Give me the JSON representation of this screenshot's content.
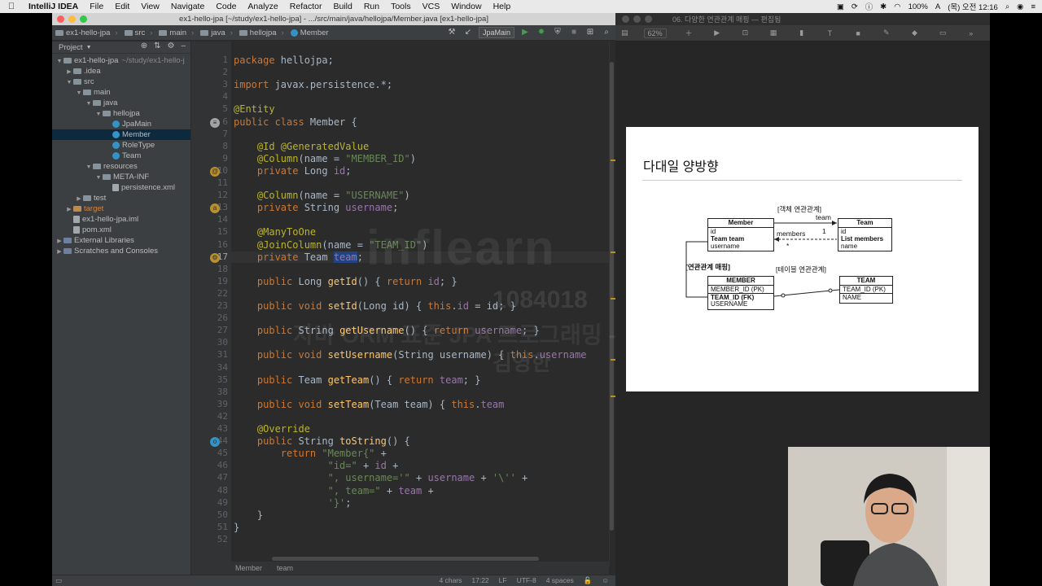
{
  "menubar": {
    "app_name": "IntelliJ IDEA",
    "items": [
      "File",
      "Edit",
      "View",
      "Navigate",
      "Code",
      "Analyze",
      "Refactor",
      "Build",
      "Run",
      "Tools",
      "VCS",
      "Window",
      "Help"
    ],
    "battery": "100%",
    "clock": "(목) 오전 12:16"
  },
  "ide": {
    "window_title": "ex1-hello-jpa [~/study/ex1-hello-jpa] - .../src/main/java/hellojpa/Member.java [ex1-hello-jpa]",
    "breadcrumbs": [
      "ex1-hello-jpa",
      "src",
      "main",
      "java",
      "hellojpa",
      "Member"
    ],
    "run_config": "JpaMain",
    "project_panel": {
      "title": "Project",
      "tree": [
        {
          "label": "ex1-hello-jpa",
          "extra": "~/study/ex1-hello-j",
          "indent": 0,
          "arrow": "▼",
          "kind": "folder"
        },
        {
          "label": ".idea",
          "indent": 1,
          "arrow": "▶",
          "kind": "folder"
        },
        {
          "label": "src",
          "indent": 1,
          "arrow": "▼",
          "kind": "folder"
        },
        {
          "label": "main",
          "indent": 2,
          "arrow": "▼",
          "kind": "folder"
        },
        {
          "label": "java",
          "indent": 3,
          "arrow": "▼",
          "kind": "folder"
        },
        {
          "label": "hellojpa",
          "indent": 4,
          "arrow": "▼",
          "kind": "folder"
        },
        {
          "label": "JpaMain",
          "indent": 5,
          "arrow": "",
          "kind": "class"
        },
        {
          "label": "Member",
          "indent": 5,
          "arrow": "",
          "kind": "class",
          "selected": true
        },
        {
          "label": "RoleType",
          "indent": 5,
          "arrow": "",
          "kind": "class"
        },
        {
          "label": "Team",
          "indent": 5,
          "arrow": "",
          "kind": "class"
        },
        {
          "label": "resources",
          "indent": 3,
          "arrow": "▼",
          "kind": "folder"
        },
        {
          "label": "META-INF",
          "indent": 4,
          "arrow": "▼",
          "kind": "folder"
        },
        {
          "label": "persistence.xml",
          "indent": 5,
          "arrow": "",
          "kind": "file"
        },
        {
          "label": "test",
          "indent": 2,
          "arrow": "▶",
          "kind": "folder"
        },
        {
          "label": "target",
          "indent": 1,
          "arrow": "▶",
          "kind": "folder-orange"
        },
        {
          "label": "ex1-hello-jpa.iml",
          "indent": 1,
          "arrow": "",
          "kind": "file"
        },
        {
          "label": "pom.xml",
          "indent": 1,
          "arrow": "",
          "kind": "file"
        },
        {
          "label": "External Libraries",
          "indent": 0,
          "arrow": "▶",
          "kind": "lib"
        },
        {
          "label": "Scratches and Consoles",
          "indent": 0,
          "arrow": "▶",
          "kind": "lib"
        }
      ]
    },
    "line_numbers": [
      "1",
      "2",
      "3",
      "4",
      "5",
      "6",
      "7",
      "8",
      "9",
      "10",
      "11",
      "12",
      "13",
      "14",
      "15",
      "16",
      "17",
      "18",
      "19",
      "22",
      "23",
      "26",
      "27",
      "30",
      "31",
      "34",
      "35",
      "38",
      "39",
      "42",
      "43",
      "44",
      "45",
      "46",
      "47",
      "48",
      "49",
      "50",
      "51",
      "52"
    ],
    "code_lines": [
      [
        [
          "kw",
          "package "
        ],
        [
          "",
          "hellojpa;"
        ]
      ],
      [],
      [
        [
          "kw",
          "import "
        ],
        [
          "",
          "javax.persistence.*;"
        ]
      ],
      [],
      [
        [
          "ann",
          "@Entity"
        ]
      ],
      [
        [
          "kw",
          "public class "
        ],
        [
          "",
          "Member {"
        ]
      ],
      [],
      [
        [
          "",
          "    "
        ],
        [
          "ann",
          "@Id @GeneratedValue"
        ]
      ],
      [
        [
          "",
          "    "
        ],
        [
          "ann",
          "@Column"
        ],
        [
          "",
          "(name = "
        ],
        [
          "str",
          "\"MEMBER_ID\""
        ],
        [
          "",
          ")"
        ]
      ],
      [
        [
          "",
          "    "
        ],
        [
          "kw",
          "private "
        ],
        [
          "",
          "Long "
        ],
        [
          "fld",
          "id"
        ],
        [
          "",
          ";"
        ]
      ],
      [],
      [
        [
          "",
          "    "
        ],
        [
          "ann",
          "@Column"
        ],
        [
          "",
          "(name = "
        ],
        [
          "str",
          "\"USERNAME\""
        ],
        [
          "",
          ")"
        ]
      ],
      [
        [
          "",
          "    "
        ],
        [
          "kw",
          "private "
        ],
        [
          "",
          "String "
        ],
        [
          "fld",
          "username"
        ],
        [
          "",
          ";"
        ]
      ],
      [],
      [
        [
          "",
          "    "
        ],
        [
          "ann",
          "@ManyToOne"
        ]
      ],
      [
        [
          "",
          "    "
        ],
        [
          "ann",
          "@JoinColumn"
        ],
        [
          "",
          "(name = "
        ],
        [
          "str",
          "\"TEAM_ID\""
        ],
        [
          "",
          ")"
        ]
      ],
      [
        [
          "",
          "    "
        ],
        [
          "kw",
          "private "
        ],
        [
          "",
          "Team "
        ],
        [
          "fldsel",
          "team"
        ],
        [
          "",
          ";"
        ]
      ],
      [],
      [
        [
          "",
          "    "
        ],
        [
          "kw",
          "public "
        ],
        [
          "",
          "Long "
        ],
        [
          "mth",
          "getId"
        ],
        [
          "",
          "() { "
        ],
        [
          "kw",
          "return "
        ],
        [
          "fld",
          "id"
        ],
        [
          "",
          "; }"
        ]
      ],
      [],
      [
        [
          "",
          "    "
        ],
        [
          "kw",
          "public void "
        ],
        [
          "mth",
          "setId"
        ],
        [
          "",
          "(Long id) { "
        ],
        [
          "kw",
          "this"
        ],
        [
          "",
          "."
        ],
        [
          "fld",
          "id"
        ],
        [
          "",
          " = id; }"
        ]
      ],
      [],
      [
        [
          "",
          "    "
        ],
        [
          "kw",
          "public "
        ],
        [
          "",
          "String "
        ],
        [
          "mth",
          "getUsername"
        ],
        [
          "",
          "() { "
        ],
        [
          "kw",
          "return "
        ],
        [
          "fld",
          "username"
        ],
        [
          "",
          "; }"
        ]
      ],
      [],
      [
        [
          "",
          "    "
        ],
        [
          "kw",
          "public void "
        ],
        [
          "mth",
          "setUsername"
        ],
        [
          "",
          "(String username) { "
        ],
        [
          "kw",
          "this"
        ],
        [
          "",
          "."
        ],
        [
          "fld",
          "username"
        ],
        [
          "",
          "",
          " = "
        ]
      ],
      [],
      [
        [
          "",
          "    "
        ],
        [
          "kw",
          "public "
        ],
        [
          "",
          "Team "
        ],
        [
          "mth",
          "getTeam"
        ],
        [
          "",
          "() { "
        ],
        [
          "kw",
          "return "
        ],
        [
          "fld",
          "team"
        ],
        [
          "",
          "; }"
        ]
      ],
      [],
      [
        [
          "",
          "    "
        ],
        [
          "kw",
          "public void "
        ],
        [
          "mth",
          "setTeam"
        ],
        [
          "",
          "(Team team) { "
        ],
        [
          "kw",
          "this"
        ],
        [
          "",
          "."
        ],
        [
          "fld",
          "team"
        ],
        [
          "",
          "",
          " = team; }"
        ]
      ],
      [],
      [
        [
          "",
          "    "
        ],
        [
          "ann",
          "@Override"
        ]
      ],
      [
        [
          "",
          "    "
        ],
        [
          "kw",
          "public "
        ],
        [
          "",
          "String "
        ],
        [
          "mth",
          "toString"
        ],
        [
          "",
          "() {"
        ]
      ],
      [
        [
          "",
          "        "
        ],
        [
          "kw",
          "return "
        ],
        [
          "str",
          "\"Member{\""
        ],
        [
          "",
          " +"
        ]
      ],
      [
        [
          "",
          "                "
        ],
        [
          "str",
          "\"id=\""
        ],
        [
          "",
          " + "
        ],
        [
          "fld",
          "id"
        ],
        [
          "",
          " +"
        ]
      ],
      [
        [
          "",
          "                "
        ],
        [
          "str",
          "\", username='\""
        ],
        [
          "",
          " + "
        ],
        [
          "fld",
          "username"
        ],
        [
          "",
          " + "
        ],
        [
          "str",
          "'\\''"
        ],
        [
          "",
          " +"
        ]
      ],
      [
        [
          "",
          "                "
        ],
        [
          "str",
          "\", team=\""
        ],
        [
          "",
          " + "
        ],
        [
          "fld",
          "team"
        ],
        [
          "",
          " +"
        ]
      ],
      [
        [
          "",
          "                "
        ],
        [
          "str",
          "'}'"
        ],
        [
          "",
          ";"
        ]
      ],
      [
        [
          "",
          "    }"
        ]
      ],
      [
        [
          "",
          "}"
        ]
      ],
      []
    ],
    "editor_breadcrumb": [
      "Member",
      "team"
    ],
    "status": {
      "chars": "4 chars",
      "position": "17:22",
      "line_sep": "LF",
      "encoding": "UTF-8",
      "indent": "4 spaces"
    }
  },
  "watermark": {
    "logo": "inflearn",
    "id": "1084018",
    "course": "자바 ORM 표준 JPA 프로그래밍 - 기본편",
    "author": "김영한"
  },
  "keynote": {
    "window_title": "06. 다양한 연관관계 매핑 — 편집됨",
    "zoom": "62%",
    "slide": {
      "title": "다대일 양방향",
      "object_label": "[객체 연관관계]",
      "table_label": "[테이블 연관관계]",
      "mapping_label": "[연관관계 매핑]",
      "member_entity": {
        "name": "Member",
        "fields": [
          "id",
          "Team team",
          "username"
        ]
      },
      "team_entity": {
        "name": "Team",
        "fields": [
          "id",
          "List members",
          "name"
        ]
      },
      "arrow_team": "team",
      "arrow_members": "members",
      "mult_one": "1",
      "mult_many": "*",
      "member_table": {
        "name": "MEMBER",
        "fields": [
          "MEMBER_ID (PK)",
          "TEAM_ID (FK)",
          "USERNAME"
        ]
      },
      "team_table": {
        "name": "TEAM",
        "fields": [
          "TEAM_ID (PK)",
          "NAME"
        ]
      }
    }
  }
}
